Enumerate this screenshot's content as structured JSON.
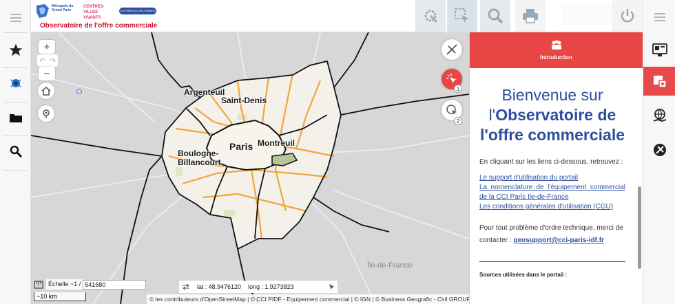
{
  "header": {
    "logo_metropole": "Métropole du Grand Paris",
    "logo_centres": "CENTRES-VILLES VIVANTS",
    "logo_cci": "CCI PARIS ILE-DE-FRANCE",
    "title": "Observatoire de l'offre commerciale",
    "tools": [
      "settings-tool-icon",
      "select-tool-icon",
      "search-tool-icon",
      "print-icon",
      "power-icon"
    ]
  },
  "left_rail": [
    "menu-icon",
    "star-icon",
    "layers-icon",
    "folder-icon",
    "search-icon"
  ],
  "right_rail": [
    "menu-icon",
    "screen-icon",
    "info-puzzle-icon",
    "globe-hand-icon",
    "tools-icon"
  ],
  "map": {
    "places": [
      "Argenteuil",
      "Saint-Denis",
      "Paris",
      "Montreuil",
      "Boulogne-Billancourt",
      "Île-de-France"
    ],
    "scale_label": "Échelle ~1 /",
    "scale_value": "541680",
    "scale_bar": "~10 km",
    "lat_label": "lat :",
    "lat": "48.9476120",
    "long_label": "long :",
    "long": "1.9273823",
    "attribution": "© les contributeurs d'OpenStreetMap | © CCI PIDF - Equipement commercial | © IGN | © Business Geografic - Ciril GROUP",
    "fab_badges": [
      "1",
      "2"
    ]
  },
  "panel": {
    "header_label": "Introduction",
    "welcome_line1": "Bienvenue sur",
    "welcome_line2_prefix": "l'",
    "welcome_line2_bold": "Observatoire de",
    "welcome_line3": "l'offre commerciale",
    "intro": "En cliquant sur les liens ci-dessous, retrouvez :",
    "links": [
      "Le support d'utilisation du portail",
      "La nomenclature de l'équipement commercial de la CCI Paris Ile-de-France",
      "Les conditions générales d'utilisation (CGU)"
    ],
    "support_text": "Pour tout problème d'ordre technique, merci de contacter :",
    "support_email": "geosupport@cci-paris-idf.fr",
    "sources": "Sources utilisées dans le portail :"
  }
}
